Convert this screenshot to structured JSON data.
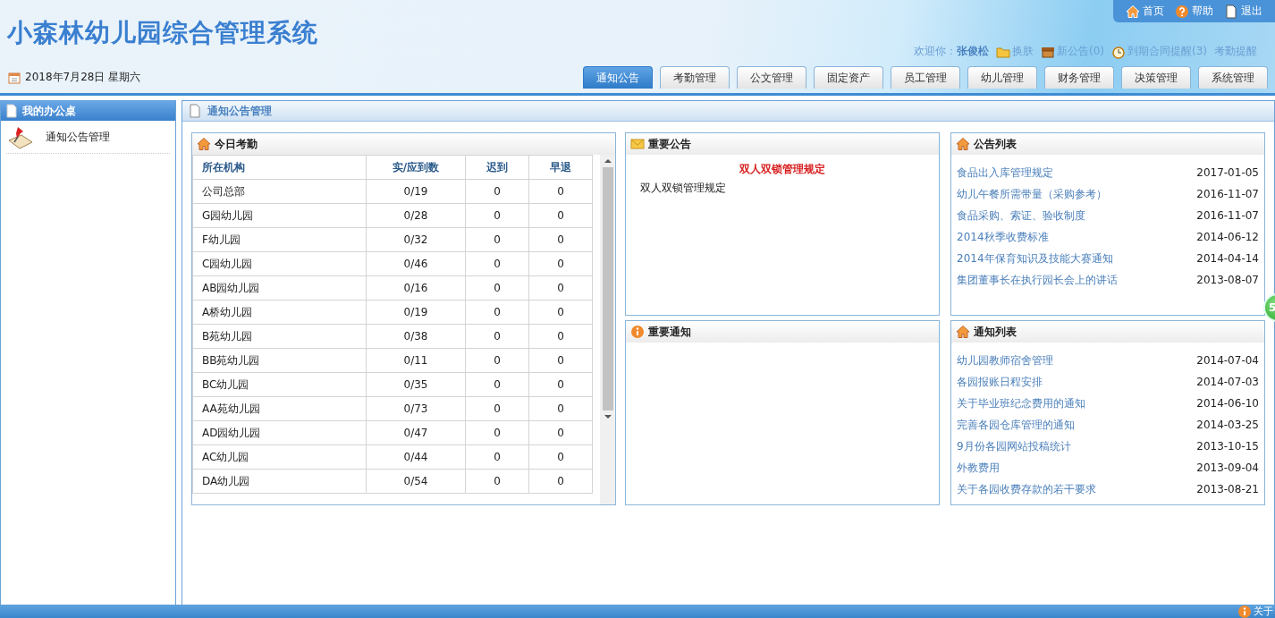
{
  "header": {
    "title": "小森林幼儿园综合管理系统",
    "date": "2018年7月28日 星期六",
    "top_links": [
      {
        "label": "首页"
      },
      {
        "label": "帮助"
      },
      {
        "label": "退出"
      }
    ],
    "welcome": {
      "label": "欢迎你：",
      "user": "张俊松"
    },
    "quick_links": [
      {
        "label": "换肤"
      },
      {
        "label": "新公告(0)"
      },
      {
        "label": "到期合同提醒(3)"
      },
      {
        "label": "考勤提醒"
      }
    ]
  },
  "tabs": [
    {
      "label": "通知公告",
      "selected": true
    },
    {
      "label": "考勤管理",
      "selected": false
    },
    {
      "label": "公文管理",
      "selected": false
    },
    {
      "label": "固定资产",
      "selected": false
    },
    {
      "label": "员工管理",
      "selected": false
    },
    {
      "label": "幼儿管理",
      "selected": false
    },
    {
      "label": "财务管理",
      "selected": false
    },
    {
      "label": "决策管理",
      "selected": false
    },
    {
      "label": "系统管理",
      "selected": false
    }
  ],
  "sidebar": {
    "title": "我的办公桌",
    "items": [
      {
        "label": "通知公告管理"
      }
    ]
  },
  "main": {
    "title": "通知公告管理",
    "attendance": {
      "title": "今日考勤",
      "columns": [
        "所在机构",
        "实/应到数",
        "迟到",
        "早退"
      ],
      "rows": [
        [
          "公司总部",
          "0/19",
          "0",
          "0"
        ],
        [
          "G园幼儿园",
          "0/28",
          "0",
          "0"
        ],
        [
          "F幼儿园",
          "0/32",
          "0",
          "0"
        ],
        [
          "C园幼儿园",
          "0/46",
          "0",
          "0"
        ],
        [
          "AB园幼儿园",
          "0/16",
          "0",
          "0"
        ],
        [
          "A桥幼儿园",
          "0/19",
          "0",
          "0"
        ],
        [
          "B苑幼儿园",
          "0/38",
          "0",
          "0"
        ],
        [
          "BB苑幼儿园",
          "0/11",
          "0",
          "0"
        ],
        [
          "BC幼儿园",
          "0/35",
          "0",
          "0"
        ],
        [
          "AA苑幼儿园",
          "0/73",
          "0",
          "0"
        ],
        [
          "AD园幼儿园",
          "0/47",
          "0",
          "0"
        ],
        [
          "AC幼儿园",
          "0/44",
          "0",
          "0"
        ],
        [
          "DA幼儿园",
          "0/54",
          "0",
          "0"
        ]
      ]
    },
    "important_notice": {
      "title": "重要公告",
      "headline": "双人双锁管理规定",
      "body": "双人双锁管理规定"
    },
    "important_notification": {
      "title": "重要通知"
    },
    "notice_list": {
      "title": "公告列表",
      "items": [
        {
          "title": "食品出入库管理规定",
          "date": "2017-01-05"
        },
        {
          "title": "幼儿午餐所需带量（采购参考）",
          "date": "2016-11-07"
        },
        {
          "title": "食品采购、索证、验收制度",
          "date": "2016-11-07"
        },
        {
          "title": "2014秋季收费标准",
          "date": "2014-06-12"
        },
        {
          "title": "2014年保育知识及技能大赛通知",
          "date": "2014-04-14"
        },
        {
          "title": "集团董事长在执行园长会上的讲话",
          "date": "2013-08-07"
        }
      ]
    },
    "notification_list": {
      "title": "通知列表",
      "items": [
        {
          "title": "幼儿园教师宿舍管理",
          "date": "2014-07-04"
        },
        {
          "title": "各园报账日程安排",
          "date": "2014-07-03"
        },
        {
          "title": "关于毕业班纪念费用的通知",
          "date": "2014-06-10"
        },
        {
          "title": "完善各园仓库管理的通知",
          "date": "2014-03-25"
        },
        {
          "title": "9月份各园网站投稿统计",
          "date": "2013-10-15"
        },
        {
          "title": "外教费用",
          "date": "2013-09-04"
        },
        {
          "title": "关于各园收费存款的若干要求",
          "date": "2013-08-21"
        }
      ]
    }
  },
  "float_badge": "5",
  "footer": {
    "about": "关于"
  }
}
